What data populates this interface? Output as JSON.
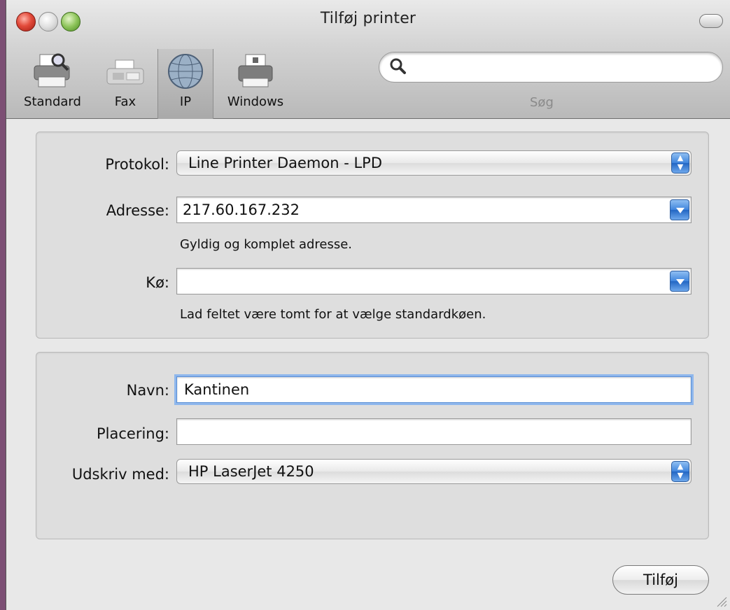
{
  "window": {
    "title": "Tilføj printer"
  },
  "toolbar": {
    "items": [
      {
        "label": "Standard",
        "icon": "printer-magnifier-icon"
      },
      {
        "label": "Fax",
        "icon": "fax-icon"
      },
      {
        "label": "IP",
        "icon": "globe-icon",
        "selected": true
      },
      {
        "label": "Windows",
        "icon": "windows-printer-icon"
      }
    ],
    "search": {
      "label": "Søg",
      "value": "",
      "icon": "search-icon"
    }
  },
  "connection": {
    "protocol": {
      "label": "Protokol:",
      "value": "Line Printer Daemon - LPD"
    },
    "address": {
      "label": "Adresse:",
      "value": "217.60.167.232",
      "hint": "Gyldig og komplet adresse."
    },
    "queue": {
      "label": "Kø:",
      "value": "",
      "hint": "Lad feltet være tomt for at vælge standardkøen."
    }
  },
  "details": {
    "name": {
      "label": "Navn:",
      "value": "Kantinen"
    },
    "location": {
      "label": "Placering:",
      "value": ""
    },
    "print_using": {
      "label": "Udskriv med:",
      "value": "HP LaserJet 4250"
    }
  },
  "actions": {
    "add_label": "Tilføj"
  },
  "colors": {
    "accent": "#3f85dd",
    "desktop": "#7c4f74",
    "window_bg": "#e8e8e8"
  }
}
